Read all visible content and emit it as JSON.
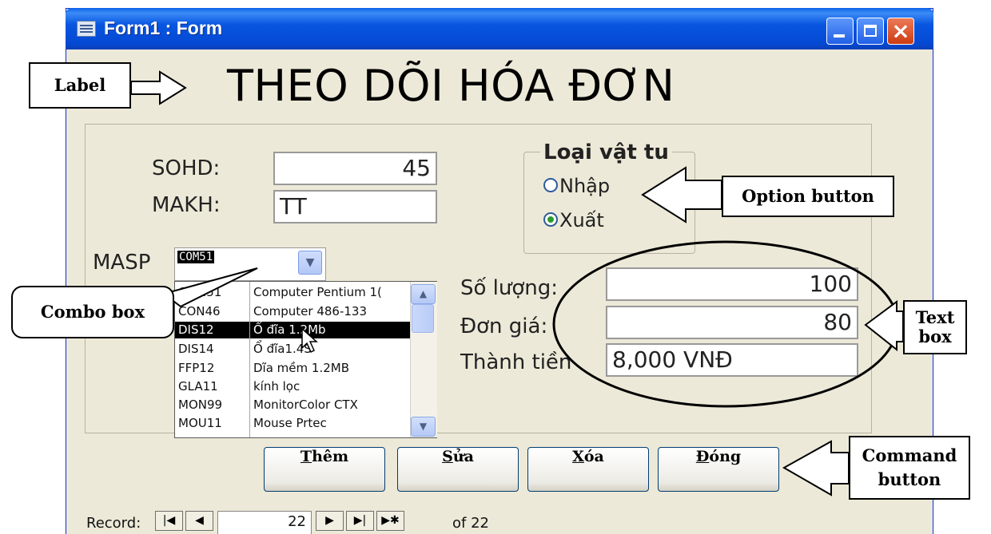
{
  "window": {
    "title": "Form1 : Form"
  },
  "form": {
    "heading": "THEO DÕI HÓA ĐƠN",
    "sohd": {
      "label": "SOHD:",
      "value": "45"
    },
    "makh": {
      "label": "MAKH:",
      "value": "TT"
    },
    "masp": {
      "label": "MASP",
      "value": "COM51"
    },
    "option_group": {
      "title": "Loại vật tu",
      "options": [
        {
          "label": "Nhập",
          "selected": false
        },
        {
          "label": "Xuất",
          "selected": true
        }
      ]
    },
    "so_luong": {
      "label": "Số lượng:",
      "value": "100"
    },
    "don_gia": {
      "label": "Đơn giá:",
      "value": "80"
    },
    "thanh_tien": {
      "label": "Thành tiền",
      "value": "8,000 VNĐ"
    },
    "combo_list": [
      {
        "code": "COM51",
        "name": "Computer Pentium 1(",
        "selected": false
      },
      {
        "code": "CON46",
        "name": "Computer 486-133",
        "selected": false
      },
      {
        "code": "DIS12",
        "name": "Ổ đĩa 1.2Mb",
        "selected": true
      },
      {
        "code": "DIS14",
        "name": "Ổ đĩa1.4S",
        "selected": false
      },
      {
        "code": "FFP12",
        "name": "Dĩa mềm 1.2MB",
        "selected": false
      },
      {
        "code": "GLA11",
        "name": "kính lọc",
        "selected": false
      },
      {
        "code": "MON99",
        "name": "MonitorColor CTX",
        "selected": false
      },
      {
        "code": "MOU11",
        "name": "Mouse Prtec",
        "selected": false
      }
    ],
    "buttons": {
      "them": {
        "hotkey": "T",
        "rest": "hêm"
      },
      "sua": {
        "hotkey": "S",
        "rest": "ửa"
      },
      "xoa": {
        "hotkey": "X",
        "rest": "óa"
      },
      "dong": {
        "hotkey": "Đ",
        "rest": "óng"
      }
    }
  },
  "record_nav": {
    "label": "Record:",
    "current": "22",
    "of_text": "of 22"
  },
  "callouts": {
    "label": "Label",
    "option_button": "Option button",
    "combo_box": "Combo box",
    "text_box_line1": "Text",
    "text_box_line2": "box",
    "command_line1": "Command",
    "command_line2": "button"
  },
  "colors": {
    "titlebar": "#0a5ae0",
    "form_bg": "#ece9d8",
    "selection": "#000000",
    "radio_dot": "#2b9c2b"
  },
  "icons": {
    "window": "form-window-icon",
    "minimize": "minimize-icon",
    "maximize": "maximize-icon",
    "close": "close-icon"
  }
}
